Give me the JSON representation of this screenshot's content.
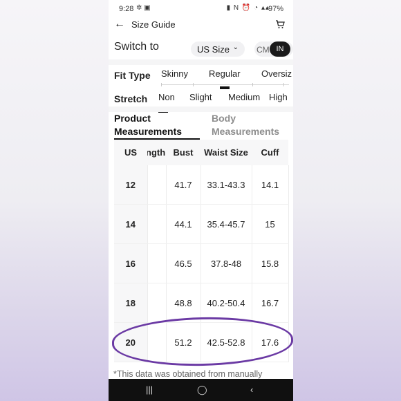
{
  "status_bar": {
    "time": "9:28",
    "battery": "97%"
  },
  "header": {
    "title": "Size Guide"
  },
  "switch": {
    "label": "Switch to",
    "size_system": "US Size",
    "unit_cm": "CM",
    "unit_in": "IN"
  },
  "fit_type": {
    "label": "Fit Type",
    "options": [
      "Skinny",
      "Regular",
      "Oversiz"
    ],
    "selected": "Regular"
  },
  "stretch": {
    "label": "Stretch",
    "options": [
      "Non",
      "Slight",
      "Medium",
      "High"
    ],
    "selected": "Non"
  },
  "tabs": [
    {
      "label": "Product Measurements",
      "active": true
    },
    {
      "label": "Body Measurements",
      "active": false
    }
  ],
  "table": {
    "headers": [
      "US",
      "Length",
      "Bust",
      "Waist Size",
      "Cuff"
    ],
    "rows": [
      {
        "us": "12",
        "bust": "41.7",
        "waist": "33.1-43.3",
        "cuff": "14.1"
      },
      {
        "us": "14",
        "bust": "44.1",
        "waist": "35.4-45.7",
        "cuff": "15"
      },
      {
        "us": "16",
        "bust": "46.5",
        "waist": "37.8-48",
        "cuff": "15.8"
      },
      {
        "us": "18",
        "bust": "48.8",
        "waist": "40.2-50.4",
        "cuff": "16.7"
      },
      {
        "us": "20",
        "bust": "51.2",
        "waist": "42.5-52.8",
        "cuff": "17.6"
      }
    ]
  },
  "footnote": "*This data was obtained from manually",
  "colors": {
    "highlight": "#6b3aa4",
    "accent": "#111111"
  }
}
